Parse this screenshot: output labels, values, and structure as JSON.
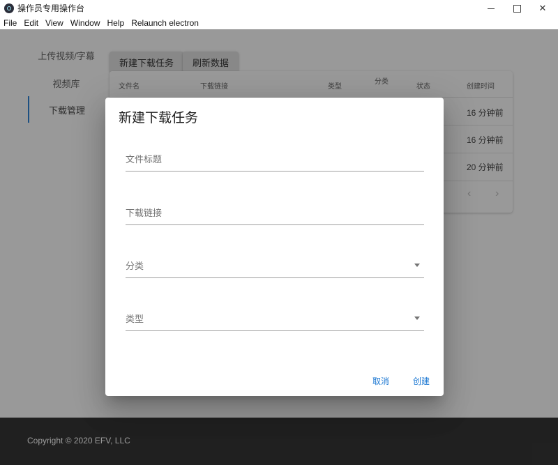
{
  "window": {
    "title": "操作员专用操作台",
    "controls": {
      "min": "minimize",
      "max": "maximize",
      "close": "✕"
    }
  },
  "menubar": {
    "items": [
      "File",
      "Edit",
      "View",
      "Window",
      "Help",
      "Relaunch electron"
    ]
  },
  "sidebar": {
    "items": [
      "上传视频/字幕",
      "视频库",
      "下载管理"
    ],
    "active": 2
  },
  "toolbar": {
    "new_task": "新建下载任务",
    "refresh": "刷新数据"
  },
  "table": {
    "headers": {
      "file_name": "文件名",
      "link": "下载链接",
      "type": "类型",
      "category": "分类",
      "status": "状态",
      "created": "创建时间"
    },
    "rows": [
      {
        "created": "16 分钟前"
      },
      {
        "created": "16 分钟前"
      },
      {
        "created": "20 分钟前"
      }
    ],
    "pager": {
      "prev": "‹",
      "next": "›"
    }
  },
  "footer": {
    "copyright": "Copyright © 2020 EFV, LLC"
  },
  "dialog": {
    "title": "新建下载任务",
    "fields": {
      "title": {
        "label": "文件标题",
        "value": ""
      },
      "link": {
        "label": "下载链接",
        "value": ""
      },
      "category": {
        "label": "分类"
      },
      "type": {
        "label": "类型"
      }
    },
    "cancel": "取消",
    "create": "创建"
  },
  "colors": {
    "accent": "#1976d2",
    "footer_bg": "#212121",
    "overlay": "rgba(33,33,33,0.46)"
  }
}
